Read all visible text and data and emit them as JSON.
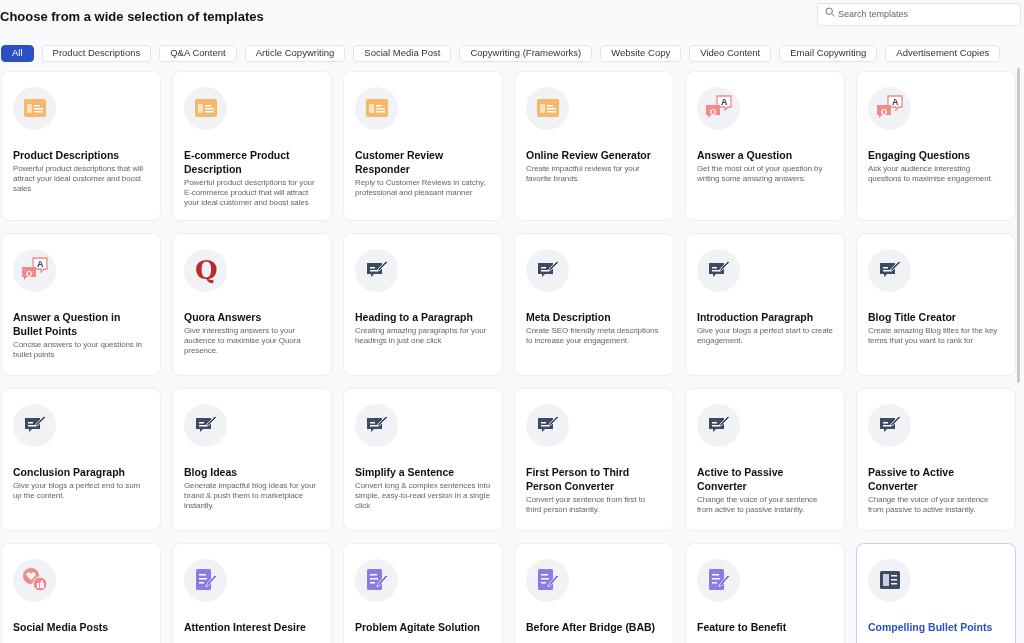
{
  "heading": "Choose from a wide selection of templates",
  "search": {
    "placeholder": "Search templates"
  },
  "tabs": [
    {
      "label": "All",
      "selected": true
    },
    {
      "label": "Product Descriptions",
      "selected": false
    },
    {
      "label": "Q&A Content",
      "selected": false
    },
    {
      "label": "Article Copywriting",
      "selected": false
    },
    {
      "label": "Social Media Post",
      "selected": false
    },
    {
      "label": "Copywriting (Frameworks)",
      "selected": false
    },
    {
      "label": "Website Copy",
      "selected": false
    },
    {
      "label": "Video Content",
      "selected": false
    },
    {
      "label": "Email Copywriting",
      "selected": false
    },
    {
      "label": "Advertisement Copies",
      "selected": false
    }
  ],
  "templates": [
    {
      "kind": "product",
      "title": "Product Descriptions",
      "description": "Powerful product descriptions that will attract your ideal customer and boost sales",
      "selected": false
    },
    {
      "kind": "product",
      "title": "E-commerce Product Description",
      "description": "Powerful product descriptions for your E-commerce product that will attract your ideal customer and boost sales",
      "selected": false
    },
    {
      "kind": "product",
      "title": "Customer Review Responder",
      "description": "Reply to Customer Reviews in catchy, professional and pleasant manner",
      "selected": false
    },
    {
      "kind": "product",
      "title": "Online Review Generator",
      "description": "Create impactful reviews for your favorite brands",
      "selected": false
    },
    {
      "kind": "qa",
      "icon_text": [
        "Q",
        "A"
      ],
      "title": "Answer a Question",
      "description": "Get the most out of your question by writing some amazing answers.",
      "selected": false
    },
    {
      "kind": "qa",
      "icon_text": [
        "Q",
        "A"
      ],
      "title": "Engaging Questions",
      "description": "Ask your audience interesting questions to maximise engagement.",
      "selected": false
    },
    {
      "kind": "qa",
      "icon_text": [
        "Q",
        "A"
      ],
      "title": "Answer a Question in Bullet Points",
      "description": "Concise answers to your questions in bullet points",
      "selected": false
    },
    {
      "kind": "quora",
      "icon_text": [
        "Q"
      ],
      "title": "Quora Answers",
      "description": "Give interesting answers to your audience to maximise your Quora presence.",
      "selected": false
    },
    {
      "kind": "article",
      "title": "Heading to a Paragraph",
      "description": "Creating amazing paragraphs for your headings in just one click",
      "selected": false
    },
    {
      "kind": "article",
      "title": "Meta Description",
      "description": "Create SEO friendly meta descriptions to increase your engagement.",
      "selected": false
    },
    {
      "kind": "article",
      "title": "Introduction Paragraph",
      "description": "Give your blogs a perfect start to create engagement.",
      "selected": false
    },
    {
      "kind": "article",
      "title": "Blog Title Creator",
      "description": "Create amazing Blog titles for the key terms that you want to rank for",
      "selected": false
    },
    {
      "kind": "article",
      "title": "Conclusion Paragraph",
      "description": "Give your blogs a perfect end to sum up the content.",
      "selected": false
    },
    {
      "kind": "article",
      "title": "Blog Ideas",
      "description": "Generate impactful blog ideas for your brand & push them to marketplace instantly.",
      "selected": false
    },
    {
      "kind": "article",
      "title": "Simplify a Sentence",
      "description": "Convert long & complex sentences into simple, easy-to-read version in a single click",
      "selected": false
    },
    {
      "kind": "article",
      "title": "First Person to Third Person Converter",
      "description": "Convert your sentence from first to third person instantly.",
      "selected": false
    },
    {
      "kind": "article",
      "title": "Active to Passive Converter",
      "description": "Change the voice of your sentence from active to passive instantly.",
      "selected": false
    },
    {
      "kind": "article",
      "title": "Passive to Active Converter",
      "description": "Change the voice of your sentence from passive to active instantly.",
      "selected": false
    },
    {
      "kind": "social",
      "title": "Social Media Posts",
      "selected": false
    },
    {
      "kind": "framework",
      "title": "Attention Interest Desire",
      "selected": false
    },
    {
      "kind": "framework",
      "title": "Problem Agitate Solution",
      "selected": false
    },
    {
      "kind": "framework",
      "title": "Before After Bridge (BAB)",
      "selected": false
    },
    {
      "kind": "framework",
      "title": "Feature to Benefit",
      "selected": false
    },
    {
      "kind": "website",
      "title": "Compelling Bullet Points",
      "selected": true
    }
  ]
}
